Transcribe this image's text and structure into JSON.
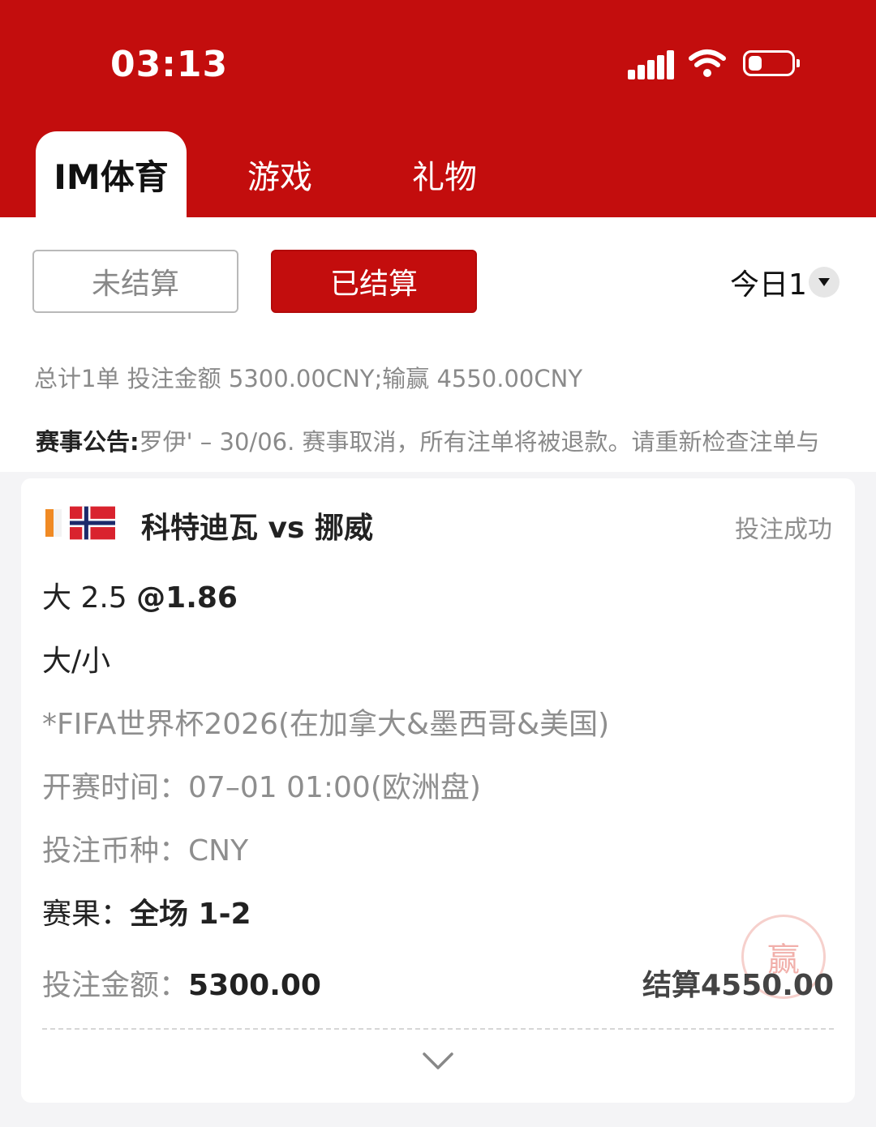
{
  "status_bar": {
    "time": "03:13"
  },
  "tabs": [
    {
      "label": "IM体育",
      "active": true
    },
    {
      "label": "游戏",
      "active": false
    },
    {
      "label": "礼物",
      "active": false
    }
  ],
  "filters": {
    "unsettled_label": "未结算",
    "settled_label": "已结算",
    "date_label": "今日1"
  },
  "summary": "总计1单 投注金额 5300.00CNY;输赢 4550.00CNY",
  "notice": {
    "label": "赛事公告:",
    "text": "罗伊' – 30/06. 赛事取消，所有注单将被退款。请重新检查注单与"
  },
  "bet": {
    "match": "科特迪瓦 vs 挪威",
    "status": "投注成功",
    "selection": "大 2.5",
    "odds": "@1.86",
    "market": "大/小",
    "league": "*FIFA世界杯2026(在加拿大&墨西哥&美国)",
    "kickoff_label": "开赛时间：",
    "kickoff_value": "07–01 01:00(欧洲盘)",
    "currency_label": "投注币种：",
    "currency_value": "CNY",
    "result_label": "赛果：",
    "result_value": "全场 1-2",
    "stake_label": "投注金额：",
    "stake_value": "5300.00",
    "settle_label": "结算",
    "settle_value": "4550.00",
    "stamp": "赢"
  },
  "colors": {
    "brand_red": "#c30d0d",
    "muted_text": "#8e8e8e"
  }
}
